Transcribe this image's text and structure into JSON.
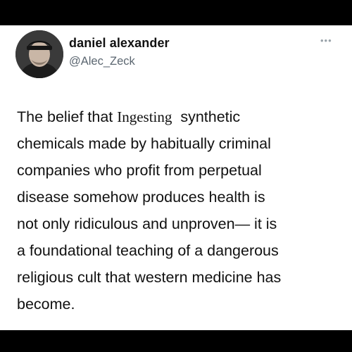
{
  "tweet": {
    "author_name": "daniel alexander",
    "author_handle": "@Alec_Zeck",
    "more_icon": "more-horizontal-icon",
    "text_lines": [
      {
        "before": "The belief that ",
        "insert": "Ingesting",
        "after": "  synthetic"
      },
      {
        "text": "chemicals made by habitually criminal"
      },
      {
        "text": "companies who profit from perpetual"
      },
      {
        "text": "disease somehow produces health is"
      },
      {
        "text": "not only ridiculous and unproven— it is"
      },
      {
        "text": "a foundational teaching of a dangerous"
      },
      {
        "text": "religious cult that western medicine has"
      },
      {
        "text": "become."
      }
    ]
  },
  "colors": {
    "frame": "#000000",
    "card": "#ffffff",
    "text": "#111111",
    "handle": "#5b6670"
  }
}
